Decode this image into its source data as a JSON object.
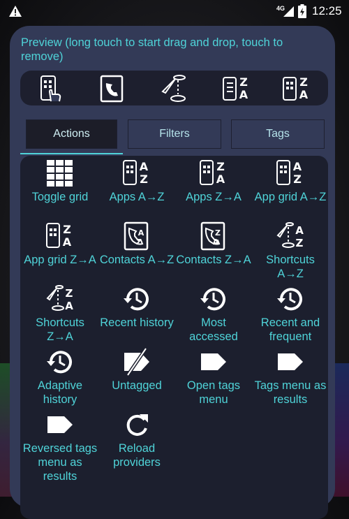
{
  "status_bar": {
    "network_label": "4G",
    "time": "12:25",
    "icons": [
      "warning-icon",
      "signal-icon",
      "battery-charging-icon"
    ]
  },
  "preview": {
    "title": "Preview (long touch to start drag and drop, touch to remove)",
    "items": [
      "app-grid-az-icon",
      "contacts-icon",
      "shortcuts-icon",
      "apps-za-icon",
      "app-grid-za-icon"
    ]
  },
  "tabs": [
    {
      "label": "Actions",
      "active": true
    },
    {
      "label": "Filters",
      "active": false
    },
    {
      "label": "Tags",
      "active": false
    }
  ],
  "actions": [
    {
      "label": "Toggle grid",
      "icon": "grid-icon"
    },
    {
      "label": "Apps A→Z",
      "icon": "apps-az-icon"
    },
    {
      "label": "Apps Z→A",
      "icon": "apps-za-icon"
    },
    {
      "label": "App grid A→Z",
      "icon": "app-grid-az-icon"
    },
    {
      "label": "App grid Z→A",
      "icon": "app-grid-za-icon"
    },
    {
      "label": "Contacts A→Z",
      "icon": "contacts-az-icon"
    },
    {
      "label": "Contacts Z→A",
      "icon": "contacts-za-icon"
    },
    {
      "label": "Shortcuts A→Z",
      "icon": "shortcuts-az-icon"
    },
    {
      "label": "Shortcuts Z→A",
      "icon": "shortcuts-za-icon"
    },
    {
      "label": "Recent history",
      "icon": "history-icon"
    },
    {
      "label": "Most accessed",
      "icon": "history-icon"
    },
    {
      "label": "Recent and frequent",
      "icon": "history-icon"
    },
    {
      "label": "Adaptive history",
      "icon": "history-icon"
    },
    {
      "label": "Untagged",
      "icon": "untagged-icon"
    },
    {
      "label": "Open tags menu",
      "icon": "tag-icon"
    },
    {
      "label": "Tags menu as results",
      "icon": "tag-icon"
    },
    {
      "label": "Reversed tags menu as results",
      "icon": "tag-icon"
    },
    {
      "label": "Reload providers",
      "icon": "reload-icon"
    }
  ]
}
